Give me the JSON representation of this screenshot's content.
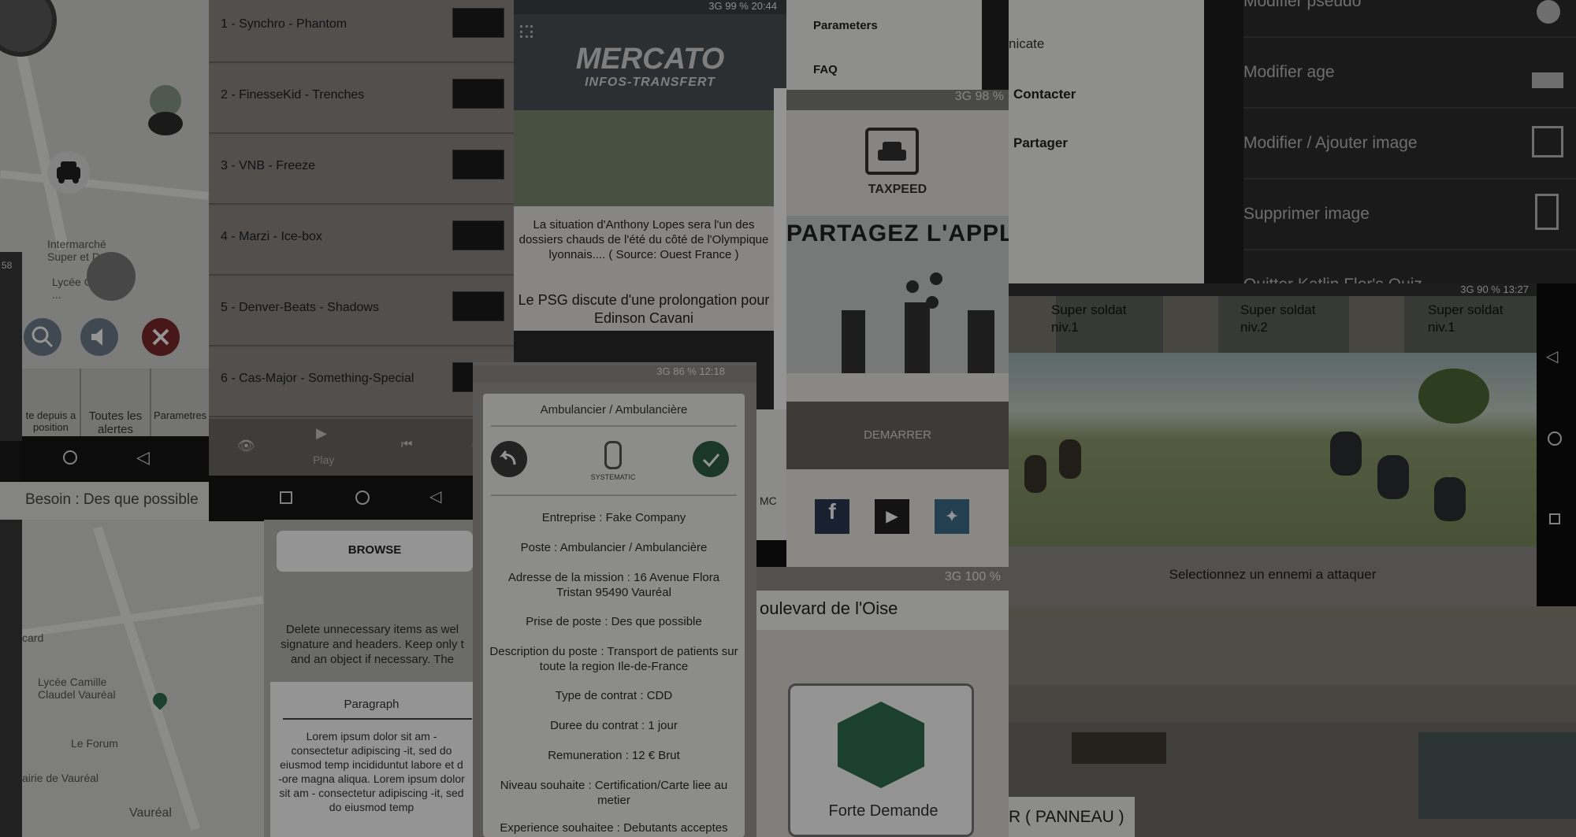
{
  "map": {
    "labels": [
      "Intermarché Super et D...",
      "Lycée Claude ...",
      "Lycée Camille Claudel Vauréal",
      "Le Forum",
      "airie de Vauréal",
      "Vauréal",
      "card"
    ],
    "side_time": "58",
    "actions": [
      "te depuis a position",
      "Toutes les alertes",
      "Parametres"
    ],
    "need_text": "Besoin : Des que possible"
  },
  "music": {
    "tracks": [
      "1 - Synchro - Phantom",
      "2 - FinesseKid - Trenches",
      "3 - VNB - Freeze",
      "4 - Marzi - Ice-box",
      "5 - Denver-Beats - Shadows",
      "6 - Cas-Major - Something-Special"
    ],
    "play_label": "Play"
  },
  "mercato": {
    "status": "3G  99 %  20:44",
    "logo_line1": "MERCATO",
    "logo_line2": "INFOS-TRANSFERT",
    "article1": "La situation d'Anthony Lopes sera l'un des dossiers chauds de l'été du côté de l'Olympique lyonnais.... ( Source: Ouest France )",
    "article2": "Le PSG discute d'une prolongation pour Edinson Cavani",
    "side_label": "MC"
  },
  "ambul": {
    "status": "3G  86 %  12:18",
    "title": "Ambulancier / Ambulancière",
    "brand": "SYSTEMATIC",
    "lines": [
      "Entreprise : Fake Company",
      "Poste : Ambulancier / Ambulancière",
      "Adresse de la mission : 16 Avenue Flora Tristan 95490 Vauréal",
      "Prise de poste : Des que possible",
      "Description du poste : Transport de patients sur toute la region Ile-de-France",
      "Type de contrat : CDD",
      "Duree du contrat : 1 jour",
      "Remuneration : 12 € Brut",
      "Niveau souhaite : Certification/Carte liee au metier",
      "Experience souhaitee : Debutants acceptes"
    ]
  },
  "taxi": {
    "menu": [
      "Parameters",
      "FAQ"
    ],
    "status": "3G  98 %",
    "brand": "TAXPEED",
    "share_title": "PARTAGEZ L'APPLI",
    "start_button": "DEMARRER"
  },
  "settings": {
    "items": [
      "nicate",
      "Contacter",
      "Partager"
    ]
  },
  "profile": {
    "rows": [
      "Modifier pseudo",
      "Modifier age",
      "Modifier / Ajouter image",
      "Supprimer image",
      "Quitter Katlin Flor's Quiz"
    ]
  },
  "game": {
    "status": "3G  90 %  13:27",
    "units": [
      {
        "name": "Super soldat",
        "level": "niv.1"
      },
      {
        "name": "Super soldat",
        "level": "niv.2"
      },
      {
        "name": "Super soldat",
        "level": "niv.1"
      }
    ],
    "prompt": "Selectionnez un ennemi a attaquer"
  },
  "browse": {
    "button": "BROWSE",
    "desc": "Delete unnecessary items as wel signature and headers. Keep only t and an object if necessary. The",
    "section": "Paragraph",
    "lorem": "Lorem ipsum dolor sit am - consectetur adipiscing -it, sed do eiusmod temp incididuntut labore et d -ore magna aliqua. Lorem ipsum dolor sit am - consectetur adipiscing -it, sed do eiusmod temp"
  },
  "oise": {
    "status": "3G  100 %",
    "street": "oulevard de l'Oise",
    "tile": "Forte Demande",
    "sign": "R ( PANNEAU )"
  },
  "colors": {
    "dark_nav": "#151515",
    "track_bg": "#8d8986",
    "mercato_head": "#4c5256",
    "profile_bg": "#2d2d2d"
  }
}
